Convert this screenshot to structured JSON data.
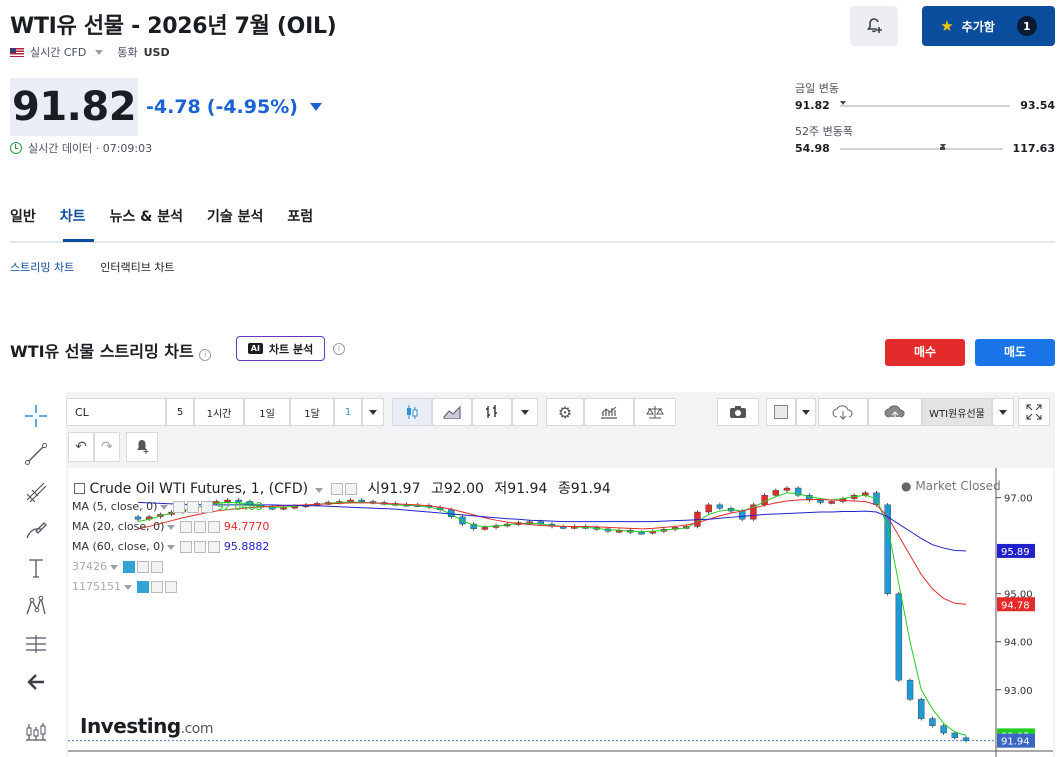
{
  "header": {
    "title": "WTI유 선물 - 2026년 7월 (OIL)",
    "realtime_cfd": "실시간 CFD",
    "currency_label": "통화",
    "currency": "USD",
    "add_label": "추가함",
    "add_count": "1"
  },
  "quote": {
    "price": "91.82",
    "change": "-4.78",
    "change_pct": "(-4.95%)",
    "realtime_text": "실시간 데이터 · 07:09:03",
    "day_range_label": "금일 변동",
    "day_low": "91.82",
    "day_high": "93.54",
    "week52_label": "52주 변동폭",
    "week52_low": "54.98",
    "week52_high": "117.63"
  },
  "tabs": [
    "일반",
    "차트",
    "뉴스 & 분석",
    "기술 분석",
    "포럼"
  ],
  "active_tab": "차트",
  "subtabs": [
    "스트리밍 차트",
    "인터랙티브 차트"
  ],
  "section": {
    "title": "WTI유 선물 스트리밍 차트",
    "ai_badge": "AI",
    "ai_label": "차트 분석",
    "sell_label": "매수",
    "buy_label": "매도"
  },
  "toolbar": {
    "symbol": "CL",
    "intervals": [
      "5",
      "1시간",
      "1일",
      "1달"
    ],
    "interval_select": "1",
    "instrument": "WTI원유선물"
  },
  "legend": {
    "instrument": "Crude Oil WTI Futures, 1, (CFD)",
    "o_label": "시",
    "o": "91.97",
    "h_label": "고",
    "h": "92.00",
    "l_label": "저",
    "l": "91.94",
    "c_label": "종",
    "c": "91.94",
    "status": "Market Closed",
    "ma5_label": "MA (5, close, 0)",
    "ma5": "92.0480",
    "ma20_label": "MA (20, close, 0)",
    "ma20": "94.7770",
    "ma60_label": "MA (60, close, 0)",
    "ma60": "95.8882",
    "ind1": "37426",
    "ind2": "1175151",
    "watermark": "Investing",
    "watermark_suffix": ".com"
  },
  "colors": {
    "brand": "#0a4d9c",
    "down": "#1a63d6",
    "up_candle": "#e32b2b",
    "down_candle": "#1e9bd6",
    "ma5": "#22cc22",
    "ma20": "#e32b2b",
    "ma60": "#2222cc"
  },
  "chart_data": {
    "type": "candlestick",
    "y_ticks": [
      "97.00",
      "95.00",
      "94.00",
      "93.00"
    ],
    "y_ticks_values": [
      97.0,
      95.0,
      94.0,
      93.0
    ],
    "price_labels": [
      {
        "name": "MA60",
        "value": "95.89",
        "color": "#2222cc"
      },
      {
        "name": "MA20",
        "value": "94.78",
        "color": "#e32b2b"
      },
      {
        "name": "MA5",
        "value": "92.05",
        "color": "#22cc22"
      },
      {
        "name": "Last",
        "value": "91.94",
        "color": "#3b66c4"
      }
    ],
    "ylim": [
      91.85,
      97.45
    ],
    "close_series": [
      96.55,
      96.6,
      96.65,
      96.7,
      96.75,
      96.8,
      96.88,
      96.92,
      96.95,
      96.92,
      96.85,
      96.8,
      96.78,
      96.8,
      96.82,
      96.85,
      96.88,
      96.9,
      96.92,
      96.95,
      96.92,
      96.9,
      96.88,
      96.86,
      96.85,
      96.84,
      96.8,
      96.75,
      96.6,
      96.45,
      96.35,
      96.38,
      96.42,
      96.45,
      96.48,
      96.5,
      96.45,
      96.4,
      96.38,
      96.4,
      96.38,
      96.35,
      96.3,
      96.32,
      96.28,
      96.27,
      96.3,
      96.34,
      96.38,
      96.4,
      96.7,
      96.85,
      96.78,
      96.72,
      96.55,
      96.85,
      97.05,
      97.15,
      97.2,
      97.05,
      96.95,
      96.9,
      96.92,
      96.98,
      97.05,
      97.1,
      96.85,
      95.0,
      93.2,
      92.8,
      92.4,
      92.25,
      92.1,
      92.0,
      91.94
    ],
    "ma5": [
      96.5,
      96.55,
      96.62,
      96.68,
      96.72,
      96.78,
      96.84,
      96.88,
      96.9,
      96.89,
      96.85,
      96.82,
      96.8,
      96.8,
      96.82,
      96.84,
      96.86,
      96.88,
      96.9,
      96.91,
      96.9,
      96.89,
      96.87,
      96.85,
      96.84,
      96.83,
      96.8,
      96.76,
      96.65,
      96.52,
      96.42,
      96.4,
      96.41,
      96.43,
      96.46,
      96.47,
      96.45,
      96.42,
      96.4,
      96.39,
      96.38,
      96.36,
      96.33,
      96.32,
      96.3,
      96.29,
      96.3,
      96.32,
      96.35,
      96.37,
      96.5,
      96.65,
      96.72,
      96.75,
      96.72,
      96.8,
      96.92,
      97.02,
      97.1,
      97.08,
      97.02,
      96.98,
      96.95,
      96.98,
      97.02,
      97.05,
      96.98,
      96.4,
      95.2,
      94.0,
      93.0,
      92.6,
      92.3,
      92.12,
      92.05
    ],
    "ma20": [
      96.35,
      96.4,
      96.46,
      96.52,
      96.58,
      96.63,
      96.68,
      96.72,
      96.75,
      96.77,
      96.79,
      96.81,
      96.82,
      96.83,
      96.84,
      96.85,
      96.86,
      96.87,
      96.88,
      96.89,
      96.89,
      96.89,
      96.88,
      96.87,
      96.86,
      96.85,
      96.83,
      96.8,
      96.76,
      96.7,
      96.64,
      96.58,
      96.53,
      96.49,
      96.46,
      96.44,
      96.42,
      96.41,
      96.4,
      96.4,
      96.4,
      96.39,
      96.38,
      96.37,
      96.36,
      96.35,
      96.36,
      96.38,
      96.4,
      96.43,
      96.48,
      96.55,
      96.62,
      96.68,
      96.72,
      96.78,
      96.84,
      96.89,
      96.93,
      96.95,
      96.96,
      96.96,
      96.95,
      96.94,
      96.93,
      96.92,
      96.85,
      96.6,
      96.2,
      95.8,
      95.4,
      95.1,
      94.9,
      94.8,
      94.78
    ],
    "ma60": [
      96.9,
      96.89,
      96.88,
      96.87,
      96.86,
      96.86,
      96.85,
      96.85,
      96.85,
      96.85,
      96.85,
      96.85,
      96.85,
      96.84,
      96.84,
      96.83,
      96.83,
      96.82,
      96.81,
      96.8,
      96.79,
      96.78,
      96.77,
      96.76,
      96.74,
      96.72,
      96.7,
      96.68,
      96.66,
      96.64,
      96.62,
      96.6,
      96.58,
      96.56,
      96.55,
      96.53,
      96.52,
      96.51,
      96.5,
      96.5,
      96.5,
      96.5,
      96.5,
      96.5,
      96.5,
      96.5,
      96.5,
      96.51,
      96.52,
      96.53,
      96.54,
      96.55,
      96.57,
      96.59,
      96.61,
      96.63,
      96.65,
      96.66,
      96.67,
      96.68,
      96.69,
      96.7,
      96.7,
      96.71,
      96.71,
      96.72,
      96.7,
      96.6,
      96.45,
      96.3,
      96.15,
      96.02,
      95.95,
      95.9,
      95.89
    ]
  }
}
